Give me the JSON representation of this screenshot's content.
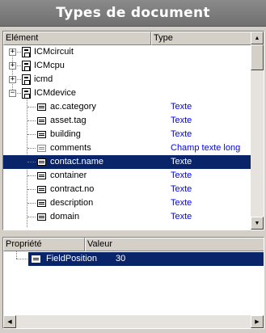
{
  "window": {
    "title": "Types de document"
  },
  "tree": {
    "columns": {
      "element": "Elément",
      "type": "Type"
    },
    "nodes": [
      {
        "label": "ICMcircuit",
        "expander": "+"
      },
      {
        "label": "ICMcpu",
        "expander": "+"
      },
      {
        "label": "icmd",
        "expander": "+"
      },
      {
        "label": "ICMdevice",
        "expander": "−"
      }
    ],
    "fields": [
      {
        "label": "ac.category",
        "type": "Texte"
      },
      {
        "label": "asset.tag",
        "type": "Texte"
      },
      {
        "label": "building",
        "type": "Texte"
      },
      {
        "label": "comments",
        "type": "Champ texte long"
      },
      {
        "label": "contact.name",
        "type": "Texte"
      },
      {
        "label": "container",
        "type": "Texte"
      },
      {
        "label": "contract.no",
        "type": "Texte"
      },
      {
        "label": "description",
        "type": "Texte"
      },
      {
        "label": "domain",
        "type": "Texte"
      }
    ]
  },
  "properties": {
    "columns": {
      "property": "Propriété",
      "value": "Valeur"
    },
    "rows": [
      {
        "name": "FieldPosition",
        "value": "30"
      }
    ]
  },
  "icons": {
    "node": "document-type-icon",
    "field": "field-icon",
    "field_long": "long-text-field-icon"
  },
  "colors": {
    "selection": "#0a246a",
    "type_text": "#0000ff",
    "title_bar": "#7a7a7a"
  }
}
